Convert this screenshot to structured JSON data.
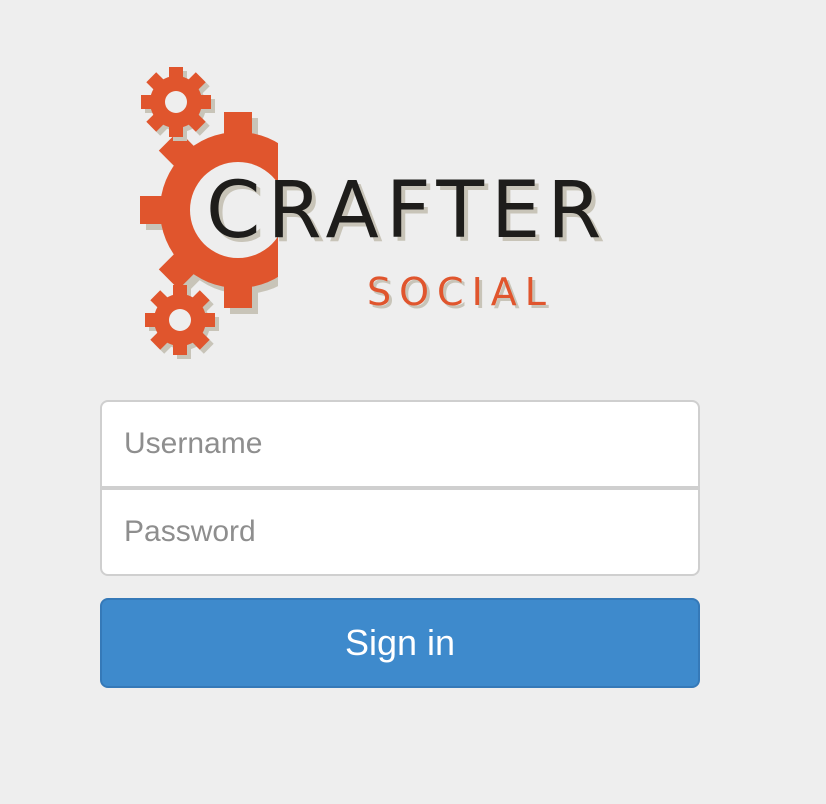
{
  "logo": {
    "brand_word": "CRAFTER",
    "sub_word": "SOCIAL",
    "gear_color": "#e0552d",
    "text_color": "#1e1d1b",
    "sub_color": "#e0552d",
    "shadow_color": "#c8c4b8"
  },
  "login": {
    "username_placeholder": "Username",
    "password_placeholder": "Password",
    "signin_label": "Sign in",
    "button_color": "#3e8acc"
  }
}
